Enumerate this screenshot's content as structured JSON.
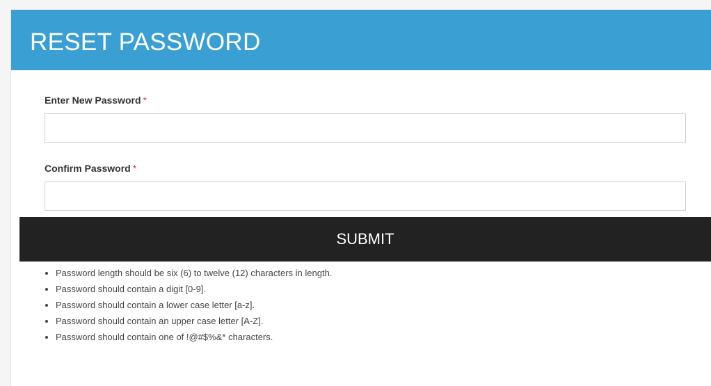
{
  "header": {
    "title": "RESET PASSWORD"
  },
  "form": {
    "new_password": {
      "label": "Enter New Password",
      "required_mark": "*",
      "value": "",
      "placeholder": ""
    },
    "confirm_password": {
      "label": "Confirm Password",
      "required_mark": "*",
      "value": "",
      "placeholder": ""
    },
    "submit_label": "SUBMIT"
  },
  "rules": [
    "Password length should be six (6) to twelve (12) characters in length.",
    "Password should contain a digit [0-9].",
    "Password should contain a lower case letter [a-z].",
    "Password should contain an upper case letter [A-Z].",
    "Password should contain one of !@#$%&* characters."
  ],
  "colors": {
    "header_background": "#3aa0d4",
    "submit_background": "#222222",
    "required_mark": "#e04040"
  }
}
